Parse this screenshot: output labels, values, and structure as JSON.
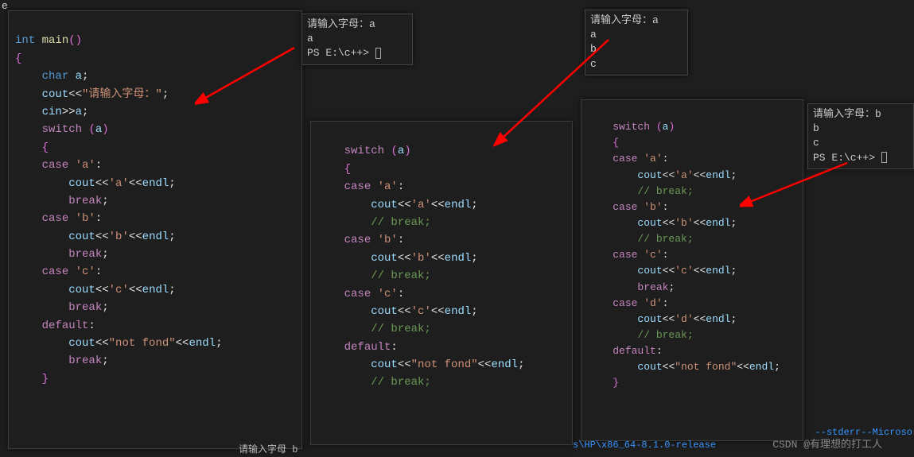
{
  "topLeft": "e",
  "pane1": {
    "l1a": "int",
    "l1b": "main",
    "l1c": "()",
    "l2": "{",
    "l3a": "char",
    "l3b": "a",
    "l3c": ";",
    "l4a": "cout",
    "l4b": "<<",
    "l4c": "\"请输入字母：\"",
    "l4d": ";",
    "l5a": "cin",
    "l5b": ">>",
    "l5c": "a",
    "l5d": ";",
    "l6a": "switch",
    "l6b": "(",
    "l6c": "a",
    "l6d": ")",
    "l7": "{",
    "l8a": "case",
    "l8b": "'a'",
    "l8c": ":",
    "l9a": "cout",
    "l9b": "<<",
    "l9c": "'a'",
    "l9d": "<<",
    "l9e": "endl",
    "l9f": ";",
    "l10a": "break",
    "l10b": ";",
    "l11a": "case",
    "l11b": "'b'",
    "l11c": ":",
    "l12a": "cout",
    "l12b": "<<",
    "l12c": "'b'",
    "l12d": "<<",
    "l12e": "endl",
    "l12f": ";",
    "l13a": "break",
    "l13b": ";",
    "l14a": "case",
    "l14b": "'c'",
    "l14c": ":",
    "l15a": "cout",
    "l15b": "<<",
    "l15c": "'c'",
    "l15d": "<<",
    "l15e": "endl",
    "l15f": ";",
    "l16a": "break",
    "l16b": ";",
    "l17a": "default",
    "l17b": ":",
    "l18a": "cout",
    "l18b": "<<",
    "l18c": "\"not fond\"",
    "l18d": "<<",
    "l18e": "endl",
    "l18f": ";",
    "l19a": "break",
    "l19b": ";",
    "l20": "}"
  },
  "pane2": {
    "l1a": "switch",
    "l1b": "(",
    "l1c": "a",
    "l1d": ")",
    "l2": "{",
    "l3a": "case",
    "l3b": "'a'",
    "l3c": ":",
    "l4a": "cout",
    "l4b": "<<",
    "l4c": "'a'",
    "l4d": "<<",
    "l4e": "endl",
    "l4f": ";",
    "l5": "// break;",
    "l6a": "case",
    "l6b": "'b'",
    "l6c": ":",
    "l7a": "cout",
    "l7b": "<<",
    "l7c": "'b'",
    "l7d": "<<",
    "l7e": "endl",
    "l7f": ";",
    "l8": "// break;",
    "l9a": "case",
    "l9b": "'c'",
    "l9c": ":",
    "l10a": "cout",
    "l10b": "<<",
    "l10c": "'c'",
    "l10d": "<<",
    "l10e": "endl",
    "l10f": ";",
    "l11": "// break;",
    "l12a": "default",
    "l12b": ":",
    "l13a": "cout",
    "l13b": "<<",
    "l13c": "\"not fond\"",
    "l13d": "<<",
    "l13e": "endl",
    "l13f": ";",
    "l14": "// break;"
  },
  "pane3": {
    "l1a": "switch",
    "l1b": "(",
    "l1c": "a",
    "l1d": ")",
    "l2": "{",
    "l3a": "case",
    "l3b": "'a'",
    "l3c": ":",
    "l4a": "cout",
    "l4b": "<<",
    "l4c": "'a'",
    "l4d": "<<",
    "l4e": "endl",
    "l4f": ";",
    "l5": "// break;",
    "l6a": "case",
    "l6b": "'b'",
    "l6c": ":",
    "l7a": "cout",
    "l7b": "<<",
    "l7c": "'b'",
    "l7d": "<<",
    "l7e": "endl",
    "l7f": ";",
    "l8": "// break;",
    "l9a": "case",
    "l9b": "'c'",
    "l9c": ":",
    "l10a": "cout",
    "l10b": "<<",
    "l10c": "'c'",
    "l10d": "<<",
    "l10e": "endl",
    "l10f": ";",
    "l11a": "break",
    "l11b": ";",
    "l12a": "case",
    "l12b": "'d'",
    "l12c": ":",
    "l13a": "cout",
    "l13b": "<<",
    "l13c": "'d'",
    "l13d": "<<",
    "l13e": "endl",
    "l13f": ";",
    "l14": "// break;",
    "l15a": "default",
    "l15b": ":",
    "l16a": "cout",
    "l16b": "<<",
    "l16c": "\"not fond\"",
    "l16d": "<<",
    "l16e": "endl",
    "l16f": ";",
    "l17": "}"
  },
  "term1": {
    "l1": "请输入字母：a",
    "l2": "a",
    "l3": "PS E:\\c++> "
  },
  "term2": {
    "l1": "请输入字母：a",
    "l2": "a",
    "l3": "b",
    "l4": "c"
  },
  "term3": {
    "l1": "请输入字母：b",
    "l2": "b",
    "l3": "c",
    "l4": "PS E:\\c++> "
  },
  "bottom1": "--stderr--Microso",
  "bottom2": "s\\HP\\x86_64-8.1.0-release",
  "watermark": "CSDN @有理想的打工人",
  "bottomTruncated": "请输入字母  b"
}
